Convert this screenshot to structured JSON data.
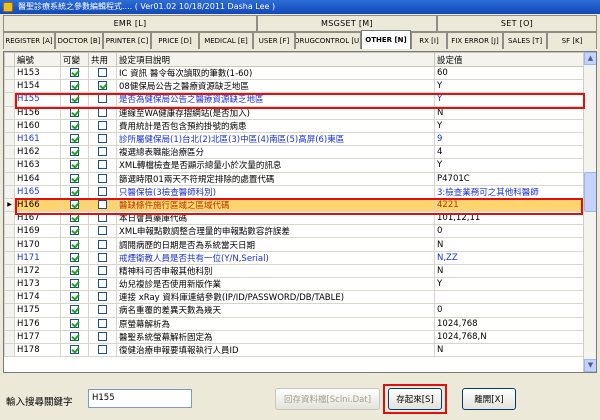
{
  "window": {
    "title": "醫聖診療系統之參數編輯程式.... ( Ver01.02 10/18/2011 Dasha Lee )"
  },
  "groups": [
    {
      "label": "EMR [L]"
    },
    {
      "label": "MSGSET [M]"
    },
    {
      "label": "SET [O]"
    }
  ],
  "tabs": [
    {
      "label": "REGISTER [A]"
    },
    {
      "label": "DOCTOR [B]"
    },
    {
      "label": "PRINTER [C]"
    },
    {
      "label": "PRICE [D]"
    },
    {
      "label": "MEDICAL [E]"
    },
    {
      "label": "USER [F]"
    },
    {
      "label": "DRUGCONTROL [U]"
    },
    {
      "label": "OTHER [N]"
    },
    {
      "label": "RX [I]"
    },
    {
      "label": "FIX ERROR [J]"
    },
    {
      "label": "SALES [T]"
    },
    {
      "label": "SF [K]"
    }
  ],
  "grid": {
    "headers": {
      "code": "編號",
      "changeable": "可變",
      "shared": "共用",
      "desc": "設定項目說明",
      "value": "設定值"
    },
    "rows": [
      {
        "code": "H153",
        "changeable": true,
        "shared": false,
        "desc": "IC 資訊 醫令每次讀取的筆數(1-60)",
        "value": "60"
      },
      {
        "code": "H154",
        "changeable": true,
        "shared": true,
        "desc": "08健保局公告之醫療資源缺乏地區",
        "value": "Y"
      },
      {
        "code": "H155",
        "changeable": true,
        "shared": false,
        "desc": "是否為健保局公告之醫療資源缺乏地區",
        "value": "Y",
        "blue": true
      },
      {
        "code": "H156",
        "changeable": true,
        "shared": false,
        "desc": "連線至WA健康存摺網站(是否加入)",
        "value": "N"
      },
      {
        "code": "H160",
        "changeable": true,
        "shared": false,
        "desc": "費用統計是否包含預約掛號的病患",
        "value": "Y"
      },
      {
        "code": "H161",
        "changeable": true,
        "shared": false,
        "desc": "診所屬健保局(1)台北(2)北區(3)中區(4)南區(5)高屏(6)東區",
        "value": "9",
        "blue": true
      },
      {
        "code": "H162",
        "changeable": true,
        "shared": false,
        "desc": "複選總表職能治療區分",
        "value": "4"
      },
      {
        "code": "H163",
        "changeable": true,
        "shared": false,
        "desc": "XML轉檔檢查是否顯示總量小於次量的訊息",
        "value": "Y"
      },
      {
        "code": "H164",
        "changeable": true,
        "shared": false,
        "desc": "篩選時限01兩天不符規定排除的處置代碼",
        "value": "P4701C"
      },
      {
        "code": "H165",
        "changeable": true,
        "shared": false,
        "desc": "只醫保檢(3檢查醫師科別)",
        "value": "3:檢查業務可之其他科醫師",
        "blue": true
      },
      {
        "code": "H166",
        "changeable": true,
        "shared": false,
        "desc": "醫缺條件施行區域之區域代碼",
        "value": "4221",
        "selected": true
      },
      {
        "code": "H167",
        "changeable": true,
        "shared": false,
        "desc": "本日會員藥庫代碼",
        "value": "101,12,11"
      },
      {
        "code": "H169",
        "changeable": true,
        "shared": false,
        "desc": "XML申報點數調整合理量的申報點數容許誤差",
        "value": "0"
      },
      {
        "code": "H170",
        "changeable": true,
        "shared": false,
        "desc": "調閱病歷的日期是否為系統當天日期",
        "value": "N"
      },
      {
        "code": "H171",
        "changeable": true,
        "shared": false,
        "desc": "戒煙衛教人員是否共有一位(Y/N,Serial)",
        "value": "N,ZZ",
        "blue": true
      },
      {
        "code": "H172",
        "changeable": true,
        "shared": false,
        "desc": "精神科可否申報其他科別",
        "value": "N"
      },
      {
        "code": "H173",
        "changeable": true,
        "shared": false,
        "desc": "幼兒複診是否使用新版作業",
        "value": "Y"
      },
      {
        "code": "H174",
        "changeable": true,
        "shared": false,
        "desc": "連接 xRay 資料庫連結參數(IP/ID/PASSWORD/DB/TABLE)",
        "value": ""
      },
      {
        "code": "H175",
        "changeable": true,
        "shared": false,
        "desc": "病名重覆的差異天數為幾天",
        "value": "0"
      },
      {
        "code": "H176",
        "changeable": true,
        "shared": false,
        "desc": "原螢幕解析為",
        "value": "1024,768"
      },
      {
        "code": "H177",
        "changeable": true,
        "shared": false,
        "desc": "醫聖系統螢幕解析固定為",
        "value": "1024,768,N"
      },
      {
        "code": "H178",
        "changeable": true,
        "shared": false,
        "desc": "復健治療申報要填報執行人員ID",
        "value": "N"
      }
    ]
  },
  "bottom": {
    "search_label": "輸入搜尋關鍵字",
    "search_value": "H155",
    "save_file_label": "回存資料檔[Sclni.Dat]",
    "save_label": "存起來[S]",
    "exit_label": "離開[X]"
  },
  "colors": {
    "highlight_box": "#e01010",
    "selected_row": "#ffd36e",
    "blue_text": "#1a30d8"
  }
}
